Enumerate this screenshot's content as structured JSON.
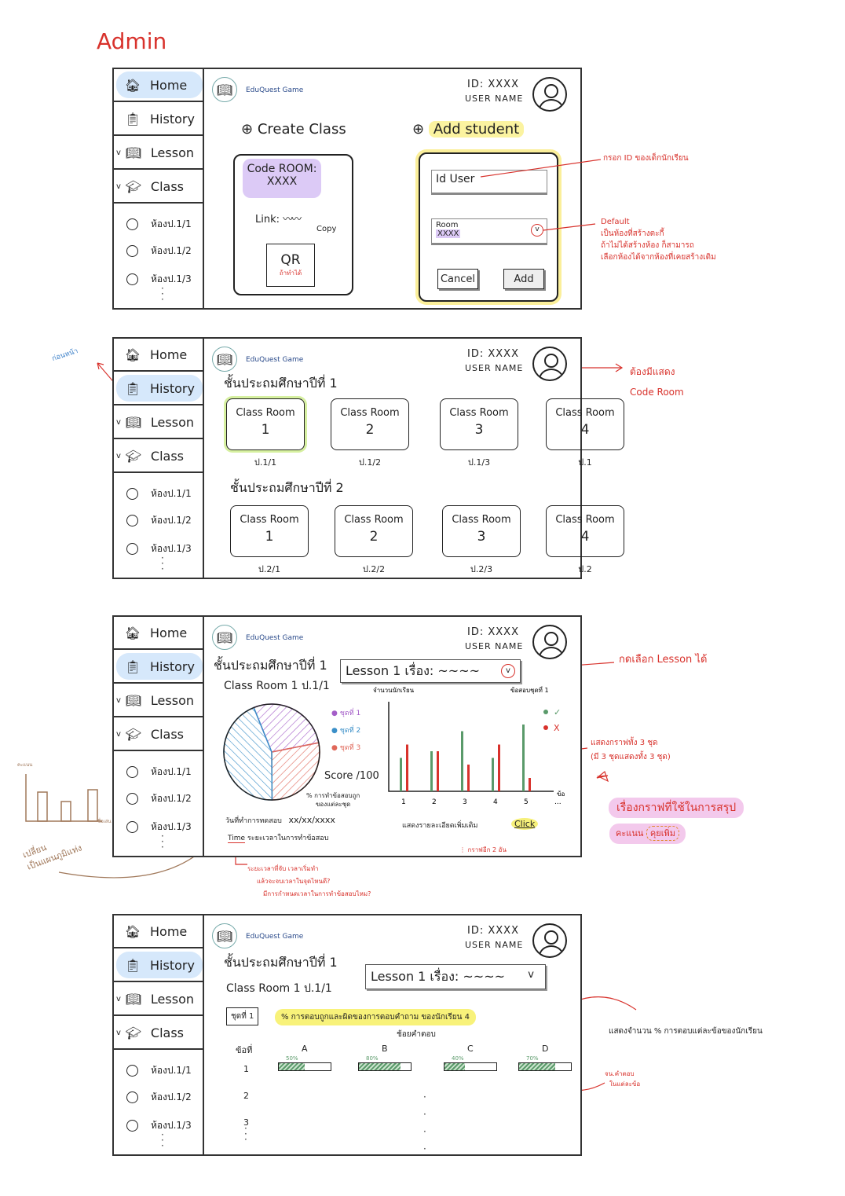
{
  "title": "Admin",
  "sidebar": {
    "items": [
      "Home",
      "History",
      "Lesson",
      "Class"
    ],
    "rooms": [
      "ห้องป.1/1",
      "ห้องป.1/2",
      "ห้องป.1/3"
    ]
  },
  "header": {
    "brand": "EduQuest Game",
    "id": "ID: XXXX",
    "user": "USER NAME"
  },
  "panel1": {
    "create_class": "Create Class",
    "code_room_label": "Code ROOM:",
    "code_room_value": "XXXX",
    "link_label": "Link:",
    "copy": "Copy",
    "qr": "QR",
    "qr_note": "ถ้าทำได้",
    "add_student": "Add student",
    "id_user_placeholder": "Id User",
    "room_label": "Room",
    "room_value": "XXXX",
    "cancel": "Cancel",
    "add": "Add",
    "note_id": "กรอก ID ของเด็กนักเรียน",
    "note_default": [
      "Default",
      "เป็นห้องที่สร้างตะกี้",
      "ถ้าไม่ได้สร้างห้อง ก็สามารถ",
      "เลือกห้องได้จากห้องที่เคยสร้างเดิม"
    ]
  },
  "panel2": {
    "grade1": "ชั้นประถมศึกษาปีที่ 1",
    "grade2": "ชั้นประถมศึกษาปีที่ 2",
    "class_room": "Class Room",
    "row1": [
      {
        "n": "1",
        "label": "ป.1/1"
      },
      {
        "n": "2",
        "label": "ป.1/2"
      },
      {
        "n": "3",
        "label": "ป.1/3"
      },
      {
        "n": "4",
        "label": "ป.1"
      }
    ],
    "row2": [
      {
        "n": "1",
        "label": "ป.2/1"
      },
      {
        "n": "2",
        "label": "ป.2/2"
      },
      {
        "n": "3",
        "label": "ป.2/3"
      },
      {
        "n": "4",
        "label": "ป.2"
      }
    ],
    "note_left": "ก่อนหน้า",
    "note_right": [
      "ต้องมีแสดง",
      "Code Room"
    ]
  },
  "panel3": {
    "grade": "ชั้นประถมศึกษาปีที่ 1",
    "class": "Class Room 1 ป.1/1",
    "lesson": "Lesson 1 เรื่อง: ~~~~",
    "score": "Score /100",
    "pct_note": [
      "% การทำข้อสอบถูก",
      "ของแต่ละชุด"
    ],
    "test_date_label": "วันที่ทำการทดสอบ",
    "test_date": "xx/xx/xxxx",
    "time_label": "Time",
    "time_desc": "ระยะเวลาในการทำข้อสอบ",
    "more": "แสดงรายละเอียดเพิ่มเติม",
    "click": "Click",
    "more_graphs": "กราฟอีก 2 อัน",
    "note_lesson": "กดเลือก Lesson ได้",
    "note_graphs": [
      "แสดงกราฟทั้ง 3 ชุด",
      "(มี 3 ชุดแสดงทั้ง 3 ชุด)"
    ],
    "note_summary": "เรื่องกราฟที่ใช้ในการสรุป",
    "note_score": "คะแนน",
    "note_discuss": "คุยเพิ่ม",
    "note_time": [
      "ระยะเวลาที่จับ เวลาเริ่มทำ",
      "แล้วจะจบเวลาในจุดไหนดี?",
      "มีการกำหนดเวลาในการทำข้อสอบไหม?"
    ],
    "note_left": [
      "คะแนน",
      "ชื่อเล่น",
      "เปลี่ยน",
      "เป็นแผนภูมิแท่ง"
    ]
  },
  "chart_data": [
    {
      "type": "pie",
      "title": "Score /100",
      "legend": [
        "ชุดที่ 1",
        "ชุดที่ 2",
        "ชุดที่ 3"
      ],
      "values": [
        28,
        44,
        28
      ],
      "colors": [
        "#a45ec8",
        "#3a8fc8",
        "#e0685a"
      ],
      "legend_placement": "right"
    },
    {
      "type": "bar",
      "ylabel": "จำนวนนักเรียน",
      "xlabel": "ข้อ",
      "legend_title": "ข้อสอบชุดที่ 1",
      "categories": [
        "1",
        "2",
        "3",
        "4",
        "5",
        "..."
      ],
      "series": [
        {
          "name": "✓",
          "color": "#5a9a6a",
          "values": [
            5,
            6,
            9,
            5,
            10
          ]
        },
        {
          "name": "X",
          "color": "#d8322c",
          "values": [
            7,
            6,
            4,
            7,
            2
          ]
        }
      ],
      "legend_placement": "top-right"
    }
  ],
  "panel4": {
    "grade": "ชั้นประถมศึกษาปีที่ 1",
    "class": "Class Room 1 ป.1/1",
    "lesson": "Lesson 1 เรื่อง: ~~~~",
    "lesson_chev": "v",
    "set": "ชุดที่ 1",
    "banner": "% การตอบถูกและผิดของการตอบคำถาม ของนักเรียน 4",
    "choices_label": "ช้อยคำตอบ",
    "q_label": "ข้อที่",
    "choices": [
      "A",
      "B",
      "C",
      "D"
    ],
    "pcts": [
      {
        "label": "50%",
        "value": 50
      },
      {
        "label": "80%",
        "value": 80
      },
      {
        "label": "40%",
        "value": 40
      },
      {
        "label": "70%",
        "value": 70
      }
    ],
    "rows": [
      "1",
      "2",
      "3"
    ],
    "note_pct": "แสดงจำนวน % การตอบแต่ละข้อของนักเรียน",
    "note_count": [
      "จน.คำตอบ",
      "ในแต่ละข้อ"
    ]
  }
}
